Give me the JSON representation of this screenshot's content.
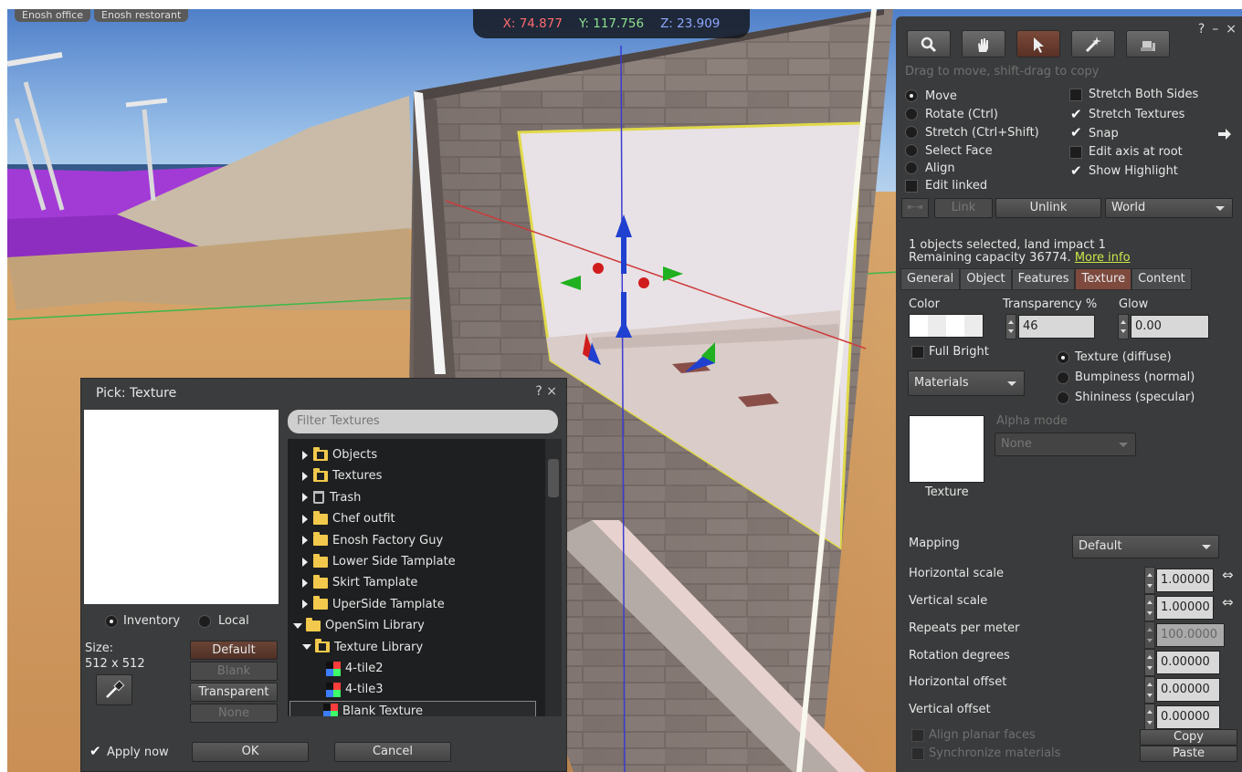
{
  "viewport": {
    "coords": {
      "x": "X: 74.877",
      "y": "Y: 117.756",
      "z": "Z: 23.909"
    },
    "crumbs": [
      "Enosh office",
      "Enosh restorant"
    ]
  },
  "build_tool": {
    "header_buttons": [
      "?",
      "–",
      "×"
    ],
    "hint": "Drag to move, shift-drag to copy",
    "modes": [
      {
        "label": "Move",
        "selected": true
      },
      {
        "label": "Rotate (Ctrl)",
        "selected": false
      },
      {
        "label": "Stretch (Ctrl+Shift)",
        "selected": false
      },
      {
        "label": "Select Face",
        "selected": false
      },
      {
        "label": "Align",
        "selected": false
      }
    ],
    "edit_linked": "Edit linked",
    "options": [
      {
        "label": "Stretch Both Sides",
        "checked": false
      },
      {
        "label": "Stretch Textures",
        "checked": true
      },
      {
        "label": "Snap",
        "checked": true
      },
      {
        "label": "Edit axis at root",
        "checked": false
      },
      {
        "label": "Show Highlight",
        "checked": true
      }
    ],
    "link_label": "Link",
    "unlink_label": "Unlink",
    "ruler": "World",
    "selection_info": "1 objects selected, land impact 1",
    "capacity_info": "Remaining capacity 36774.",
    "more_info": "More info",
    "tabs": [
      "General",
      "Object",
      "Features",
      "Texture",
      "Content"
    ],
    "active_tab": "Texture",
    "texture": {
      "color_label": "Color",
      "transparency_label": "Transparency %",
      "transparency_value": "46",
      "glow_label": "Glow",
      "glow_value": "0.00",
      "full_bright": "Full Bright",
      "materials": "Materials",
      "channels": [
        {
          "label": "Texture (diffuse)",
          "selected": true
        },
        {
          "label": "Bumpiness (normal)",
          "selected": false
        },
        {
          "label": "Shininess (specular)",
          "selected": false
        }
      ],
      "alpha_mode_label": "Alpha mode",
      "alpha_mode_value": "None",
      "texture_label": "Texture",
      "mapping_label": "Mapping",
      "mapping_value": "Default",
      "params": [
        {
          "label": "Horizontal scale",
          "value": "1.00000",
          "disabled": false
        },
        {
          "label": "Vertical scale",
          "value": "1.00000",
          "disabled": false
        },
        {
          "label": "Repeats per meter",
          "value": "100.0000",
          "disabled": true
        },
        {
          "label": "Rotation degrees",
          "value": "0.00000",
          "disabled": false
        },
        {
          "label": "Horizontal offset",
          "value": "0.00000",
          "disabled": false
        },
        {
          "label": "Vertical offset",
          "value": "0.00000",
          "disabled": false
        }
      ],
      "align_planar": "Align planar faces",
      "sync_materials": "Synchronize materials",
      "copy_label": "Copy",
      "paste_label": "Paste"
    }
  },
  "picker": {
    "title": "Pick: Texture",
    "help": "?",
    "close": "×",
    "filter_placeholder": "Filter Textures",
    "source_inventory": "Inventory",
    "source_local": "Local",
    "size_label": "Size:",
    "size_value": "512 x 512",
    "buttons": {
      "default": "Default",
      "blank": "Blank",
      "transparent": "Transparent",
      "none": "None"
    },
    "apply_now": "Apply now",
    "ok": "OK",
    "cancel": "Cancel",
    "tree": [
      {
        "label": "Objects",
        "kind": "folder-dark",
        "arrow": "r",
        "indent": 0
      },
      {
        "label": "Textures",
        "kind": "folder-dark",
        "arrow": "r",
        "indent": 0
      },
      {
        "label": "Trash",
        "kind": "trash",
        "arrow": "r",
        "indent": 0
      },
      {
        "label": "Chef outfit",
        "kind": "folder",
        "arrow": "r",
        "indent": 0
      },
      {
        "label": "Enosh Factory Guy",
        "kind": "folder",
        "arrow": "r",
        "indent": 0
      },
      {
        "label": "Lower Side Tamplate",
        "kind": "folder",
        "arrow": "r",
        "indent": 0
      },
      {
        "label": "Skirt Tamplate",
        "kind": "folder",
        "arrow": "r",
        "indent": 0
      },
      {
        "label": "UperSide Tamplate",
        "kind": "folder",
        "arrow": "r",
        "indent": 0
      },
      {
        "label": "OpenSim Library",
        "kind": "folder",
        "arrow": "d",
        "indent": -10
      },
      {
        "label": "Texture Library",
        "kind": "folder-dark",
        "arrow": "d",
        "indent": 0
      },
      {
        "label": "4-tile2",
        "kind": "tex",
        "arrow": "",
        "indent": 26
      },
      {
        "label": "4-tile3",
        "kind": "tex",
        "arrow": "",
        "indent": 26
      },
      {
        "label": "Blank Texture",
        "kind": "tex",
        "arrow": "",
        "indent": 26,
        "selected": true
      }
    ]
  }
}
